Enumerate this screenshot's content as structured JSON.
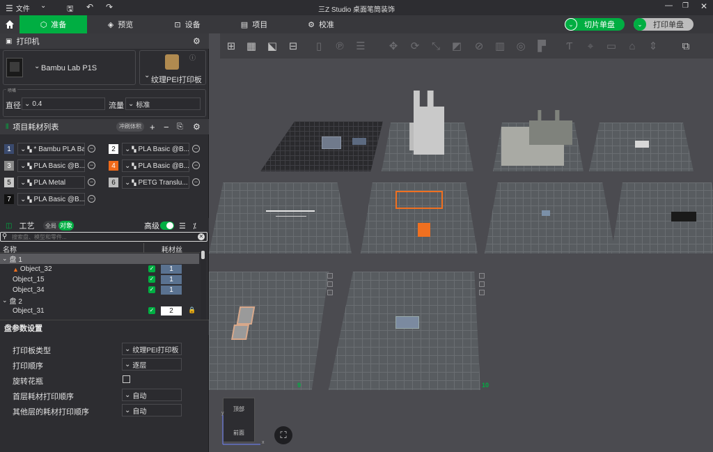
{
  "titlebar": {
    "menu_label": "文件",
    "title": "三Z Studio 桌面笔筒装饰"
  },
  "tabs": [
    {
      "label": "准备",
      "icon": "cube-icon"
    },
    {
      "label": "预览",
      "icon": "layers-icon"
    },
    {
      "label": "设备",
      "icon": "device-icon"
    },
    {
      "label": "项目",
      "icon": "project-icon"
    },
    {
      "label": "校准",
      "icon": "calibrate-icon"
    }
  ],
  "actions": {
    "slice_label": "切片单盘",
    "print_label": "打印单盘"
  },
  "printer": {
    "section_title": "打印机",
    "name": "Bambu Lab P1S",
    "plate_type": "纹理PEI打印板",
    "nozzle_group_label": "喷嘴",
    "diameter_label": "直径",
    "diameter_value": "0.4",
    "flow_label": "流量",
    "flow_value": "标准"
  },
  "filaments": {
    "section_title": "项目耗材列表",
    "flush_button": "冲刷体积",
    "items": [
      {
        "num": "1",
        "name": "* Bambu PLA Ba...",
        "color": "#3a4a6e"
      },
      {
        "num": "2",
        "name": "PLA Basic @B...",
        "color": "#ffffff"
      },
      {
        "num": "3",
        "name": "PLA Basic @B...",
        "color": "#8a8a8a"
      },
      {
        "num": "4",
        "name": "PLA Basic @B...",
        "color": "#f06a1a"
      },
      {
        "num": "5",
        "name": "PLA Metal",
        "color": "#c8c8c8"
      },
      {
        "num": "6",
        "name": "PETG Translu...",
        "color": "#bcbcbc"
      },
      {
        "num": "7",
        "name": "PLA Basic @B...",
        "color": "#111111"
      }
    ]
  },
  "process": {
    "section_title": "工艺",
    "global_label": "全局",
    "object_label": "对象",
    "advanced_label": "高级",
    "search_placeholder": "搜索盘、模型和零件...",
    "col_name": "名称",
    "col_filament": "耗材丝",
    "tree": [
      {
        "label": "盘 1",
        "type": "plate"
      },
      {
        "label": "Object_32",
        "type": "object",
        "filament": "1",
        "warn": true
      },
      {
        "label": "Object_15",
        "type": "object",
        "filament": "1"
      },
      {
        "label": "Object_34",
        "type": "object",
        "filament": "1"
      },
      {
        "label": "盘 2",
        "type": "plate"
      },
      {
        "label": "Object_31",
        "type": "object",
        "filament": "2",
        "locked": true
      }
    ]
  },
  "plate_settings": {
    "section_title": "盘参数设置",
    "rows": [
      {
        "label": "打印板类型",
        "value": "纹理PEI打印板"
      },
      {
        "label": "打印顺序",
        "value": "逐层"
      },
      {
        "label": "旋转花瓶",
        "value": ""
      },
      {
        "label": "首层耗材打印顺序",
        "value": "自动"
      },
      {
        "label": "其他层的耗材打印顺序",
        "value": "自动"
      }
    ]
  },
  "viewport": {
    "plate_numbers": [
      "9",
      "10"
    ],
    "view_cube_top": "顶部",
    "view_cube_front": "前面",
    "axis_x": "x",
    "axis_y": "y"
  }
}
